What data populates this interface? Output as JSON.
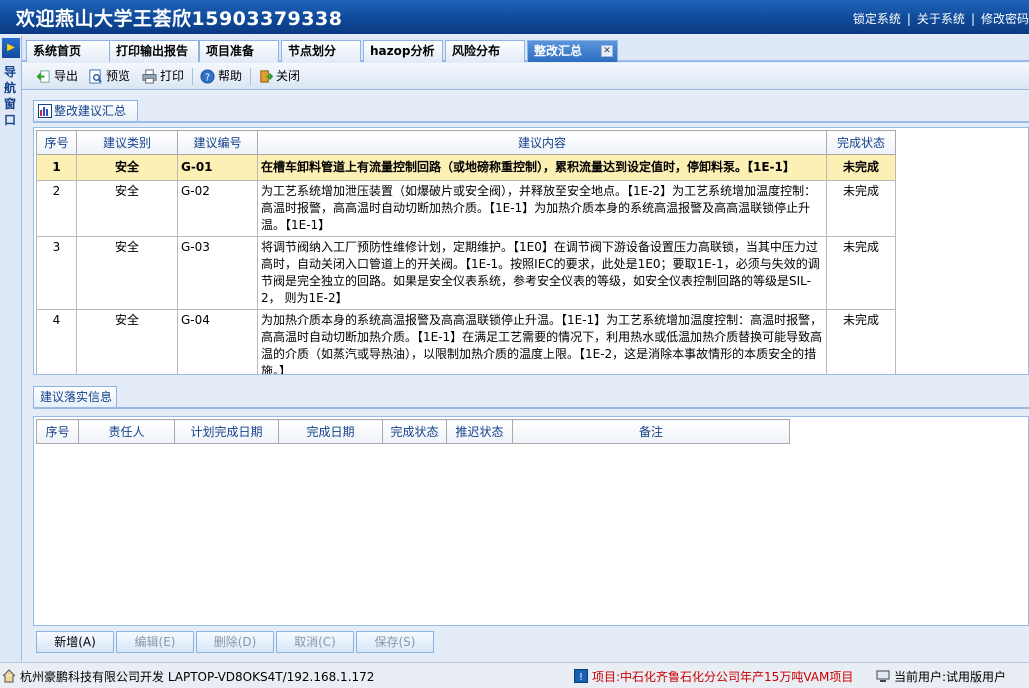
{
  "header": {
    "title": "欢迎燕山大学王荟欣15903379338",
    "links": [
      "锁定系统",
      "关于系统",
      "修改密码"
    ]
  },
  "leftnav": {
    "label": "导航窗口"
  },
  "tabs": [
    {
      "label": "系统首页"
    },
    {
      "label": "打印输出报告"
    },
    {
      "label": "项目准备"
    },
    {
      "label": "节点划分"
    },
    {
      "label": "hazop分析"
    },
    {
      "label": "风险分布"
    },
    {
      "label": "整改汇总",
      "active": true
    }
  ],
  "toolbar": {
    "export": "导出",
    "preview": "预览",
    "print": "打印",
    "help": "帮助",
    "close": "关闭"
  },
  "summary_panel": {
    "tab_label": "整改建议汇总",
    "columns": [
      "序号",
      "建议类别",
      "建议编号",
      "建议内容",
      "完成状态"
    ],
    "rows": [
      {
        "no": "1",
        "category": "安全",
        "code": "G-01",
        "content": "在槽车卸料管道上有流量控制回路（或地磅称重控制），累积流量达到设定值时，停卸料泵。【1E-1】",
        "status": "未完成",
        "selected": true
      },
      {
        "no": "2",
        "category": "安全",
        "code": "G-02",
        "content": "为工艺系统增加泄压装置（如爆破片或安全阀），并释放至安全地点。【1E-2】为工艺系统增加温度控制：高温时报警，高高温时自动切断加热介质。【1E-1】为加热介质本身的系统高温报警及高高温联锁停止升温。【1E-1】",
        "status": "未完成"
      },
      {
        "no": "3",
        "category": "安全",
        "code": "G-03",
        "content": "将调节阀纳入工厂预防性维修计划，定期维护。【1E0】在调节阀下游设备设置压力高联锁，当其中压力过高时，自动关闭入口管道上的开关阀。【1E-1。按照IEC的要求，此处是1E0；要取1E-1，必须与失效的调节阀是完全独立的回路。如果是安全仪表系统，参考安全仪表的等级，如安全仪表控制回路的等级是SIL-2， 则为1E-2】",
        "status": "未完成"
      },
      {
        "no": "4",
        "category": "安全",
        "code": "G-04",
        "content": "为加热介质本身的系统高温报警及高高温联锁停止升温。【1E-1】为工艺系统增加温度控制：高温时报警，高高温时自动切断加热介质。【1E-1】在满足工艺需要的情况下，利用热水或低温加热介质替换可能导致高温的介质（如蒸汽或导热油），以限制加热介质的温度上限。【1E-2，这是消除本事故情形的本质安全的措施。】",
        "status": "未完成"
      }
    ]
  },
  "implementation_panel": {
    "tab_label": "建议落实信息",
    "columns": [
      "序号",
      "责任人",
      "计划完成日期",
      "完成日期",
      "完成状态",
      "推迟状态",
      "备注"
    ]
  },
  "buttons": {
    "add": "新增(A)",
    "edit": "编辑(E)",
    "delete": "删除(D)",
    "cancel": "取消(C)",
    "save": "保存(S)"
  },
  "statusbar": {
    "company": "杭州豪鹏科技有限公司开发  LAPTOP-VD8OKS4T/192.168.1.172",
    "project": "项目:中石化齐鲁石化分公司年产15万吨VAM项目",
    "user": "当前用户:试用版用户"
  },
  "colors": {
    "header_bg": "#0f4a9a",
    "active_tab_bg": "#2d6dc0",
    "selected_row_bg": "#fdf0b4",
    "project_text": "#cc0000"
  }
}
